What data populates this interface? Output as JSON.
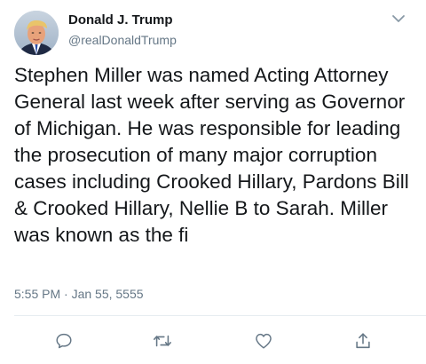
{
  "tweet": {
    "author_name": "Donald J. Trump",
    "author_handle": "@realDonaldTrump",
    "text": "Stephen Miller was named Acting Attorney General last week after serving as Governor of Michigan. He was responsible for leading the prosecution of many major corruption cases including Crooked Hillary, Pardons Bill & Crooked Hillary, Nellie B to Sarah. Miller was known as the fi",
    "timestamp": "5:55 PM · Jan 55, 5555"
  },
  "icons": {
    "menu": "chevron-down-icon",
    "reply": "reply-icon",
    "retweet": "retweet-icon",
    "like": "heart-icon",
    "share": "share-icon"
  },
  "colors": {
    "text": "#14171a",
    "secondary": "#657786",
    "icon": "#657786",
    "divider": "#e6ecf0"
  }
}
